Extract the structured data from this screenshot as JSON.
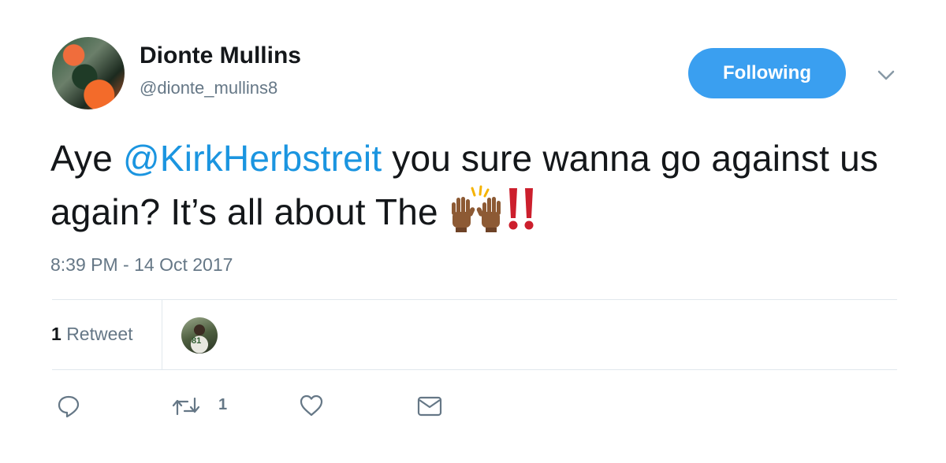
{
  "user": {
    "name": "Dionte Mullins",
    "handle": "@dionte_mullins8"
  },
  "follow_button": {
    "label": "Following"
  },
  "tweet": {
    "text_before": "Aye ",
    "mention": "@KirkHerbstreit",
    "text_after": " you sure wanna go against us again? It’s all about The ",
    "emojis": [
      "raising-hands-emoji",
      "double-exclamation-emoji"
    ],
    "timestamp": "8:39 PM - 14 Oct 2017"
  },
  "stats": {
    "retweet_count": "1",
    "retweet_label": "Retweet",
    "retweeter_jersey": "81"
  },
  "actions": {
    "reply_icon": "reply-icon",
    "retweet_icon": "retweet-icon",
    "retweet_count": "1",
    "like_icon": "heart-icon",
    "message_icon": "envelope-icon"
  },
  "colors": {
    "accent": "#1da1f2",
    "button": "#3a9ff0",
    "mention": "#1b95e0",
    "muted": "#657786",
    "emoji_red": "#cc1f2d"
  }
}
